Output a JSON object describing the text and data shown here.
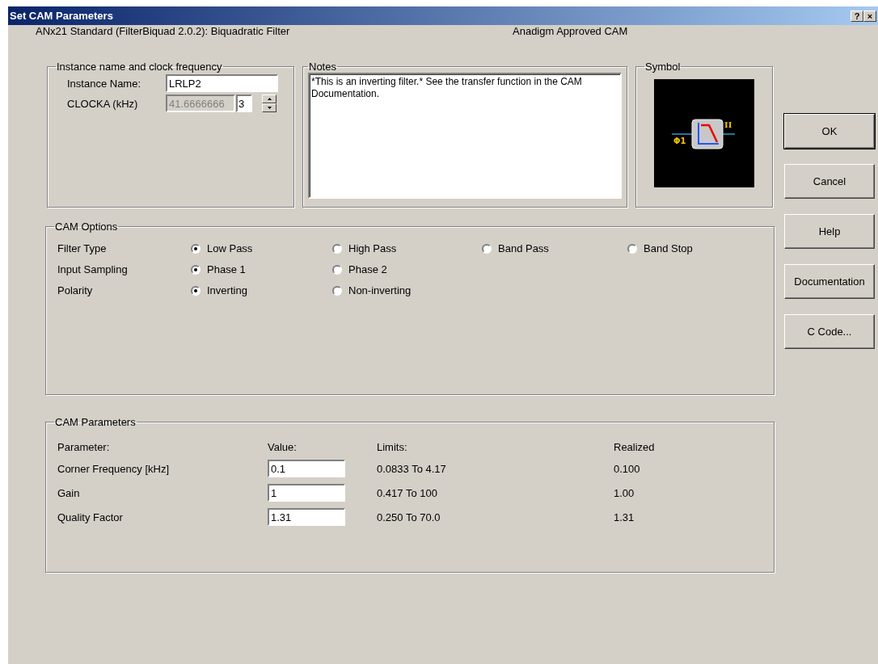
{
  "window": {
    "title": "Set CAM Parameters",
    "title_buttons": [
      "?",
      "×"
    ]
  },
  "header": {
    "cam_name": "ANx21 Standard (FilterBiquad 2.0.2):  Biquadratic Filter",
    "approval": "Anadigm Approved CAM"
  },
  "instance": {
    "title": "Instance name and clock frequency",
    "name_label": "Instance Name:",
    "name_value": "LRLP2",
    "clock_label": "CLOCKA (kHz)",
    "clock_value": "41.6666666",
    "clock_divider": "3",
    "clock_disabled": true
  },
  "notes": {
    "title": "Notes",
    "text": "*This is an inverting filter.*  See the transfer function in the CAM Documentation."
  },
  "symbol": {
    "title": "Symbol",
    "input_label": "Φ1",
    "output_label": "II"
  },
  "cam_options": {
    "title": "CAM Options",
    "rows": [
      {
        "label": "Filter Type",
        "options": [
          {
            "label": "Low Pass",
            "selected": true
          },
          {
            "label": "High Pass",
            "selected": false
          },
          {
            "label": "Band Pass",
            "selected": false
          },
          {
            "label": "Band Stop",
            "selected": false
          }
        ]
      },
      {
        "label": "Input Sampling",
        "options": [
          {
            "label": "Phase 1",
            "selected": true
          },
          {
            "label": "Phase 2",
            "selected": false
          }
        ]
      },
      {
        "label": "Polarity",
        "options": [
          {
            "label": "Inverting",
            "selected": true
          },
          {
            "label": "Non-inverting",
            "selected": false
          }
        ]
      }
    ]
  },
  "cam_parameters": {
    "title": "CAM Parameters",
    "columns": [
      "Parameter:",
      "Value:",
      "Limits:",
      "Realized"
    ],
    "rows": [
      {
        "parameter": "Corner Frequency [kHz]",
        "value": "0.1",
        "limits": "0.0833 To 4.17",
        "realized": "0.100"
      },
      {
        "parameter": "Gain",
        "value": "1",
        "limits": "0.417 To 100",
        "realized": "1.00"
      },
      {
        "parameter": "Quality Factor",
        "value": "1.31",
        "limits": "0.250 To 70.0",
        "realized": "1.31"
      }
    ]
  },
  "buttons": [
    {
      "label": "OK",
      "default": true
    },
    {
      "label": "Cancel",
      "default": false
    },
    {
      "label": "Help",
      "default": false
    },
    {
      "label": "Documentation",
      "default": false
    },
    {
      "label": "C Code...",
      "default": false
    }
  ]
}
